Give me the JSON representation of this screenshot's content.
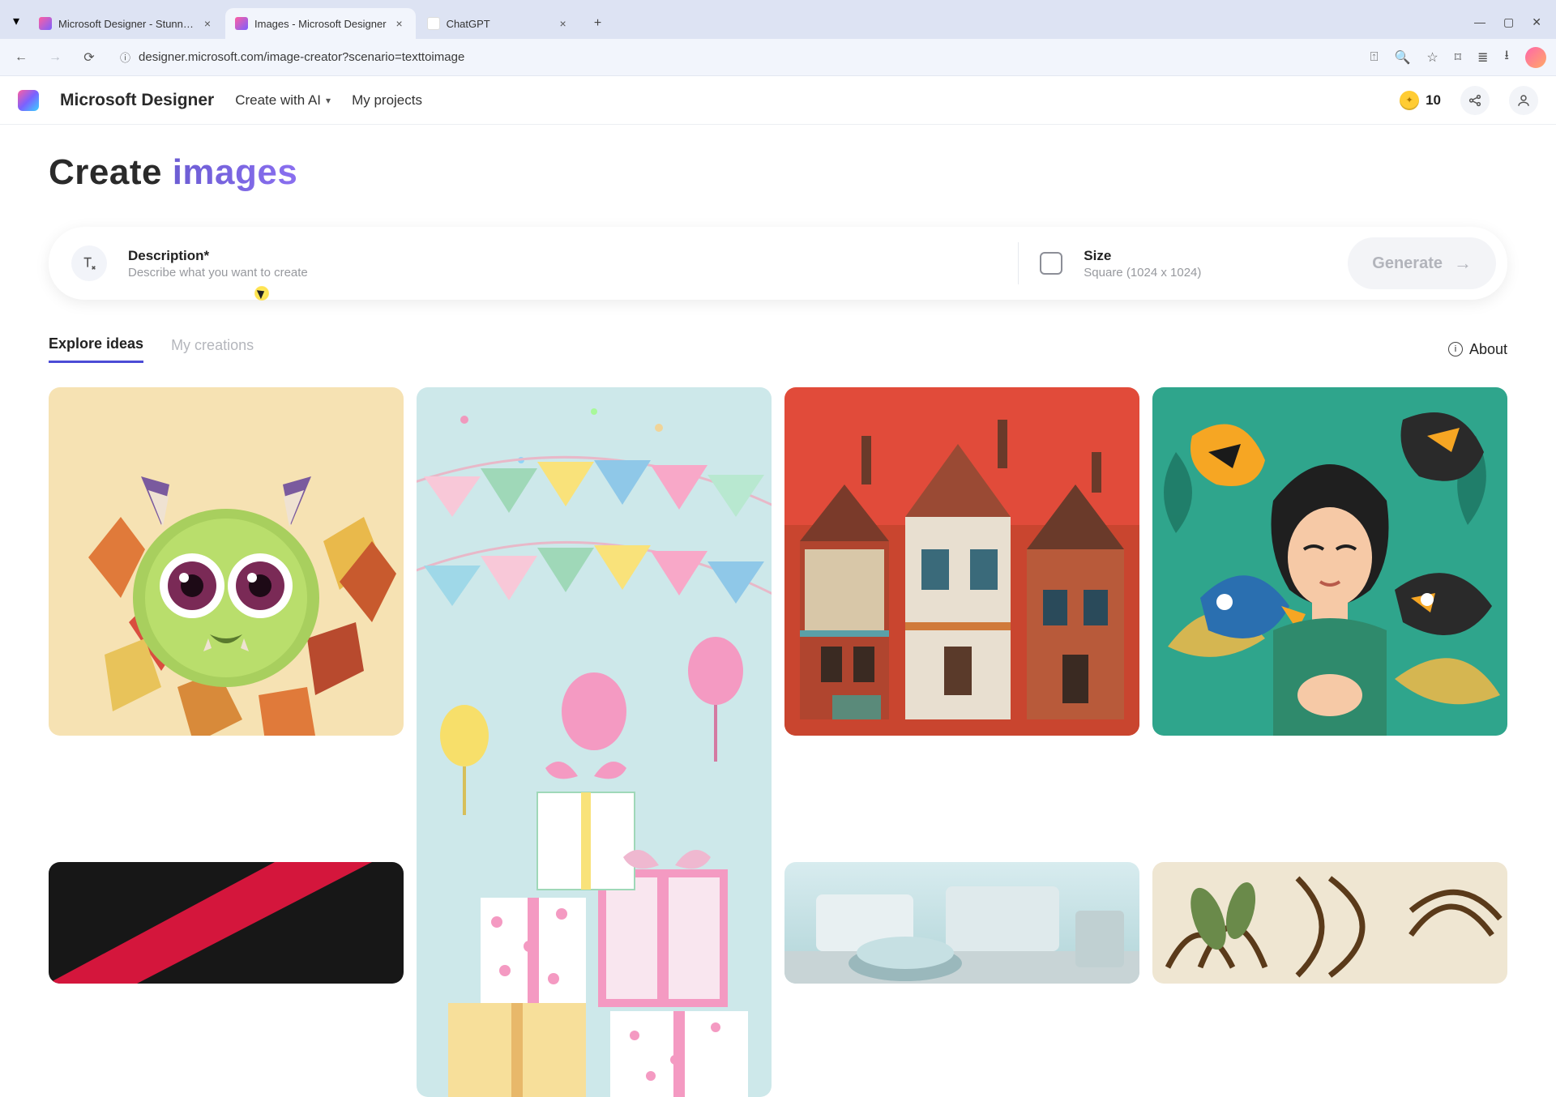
{
  "browser": {
    "tabs": [
      {
        "title": "Microsoft Designer - Stunning"
      },
      {
        "title": "Images - Microsoft Designer"
      },
      {
        "title": "ChatGPT"
      }
    ],
    "url": "designer.microsoft.com/image-creator?scenario=texttoimage"
  },
  "header": {
    "brand": "Microsoft Designer",
    "nav_create": "Create with AI",
    "nav_projects": "My projects",
    "credits": "10"
  },
  "page": {
    "title_prefix": "Create ",
    "title_accent": "images",
    "description_label": "Description*",
    "description_placeholder": "Describe what you want to create",
    "size_label": "Size",
    "size_value": "Square (1024 x 1024)",
    "generate_label": "Generate",
    "tab_explore": "Explore ideas",
    "tab_mycreations": "My creations",
    "about_label": "About"
  }
}
